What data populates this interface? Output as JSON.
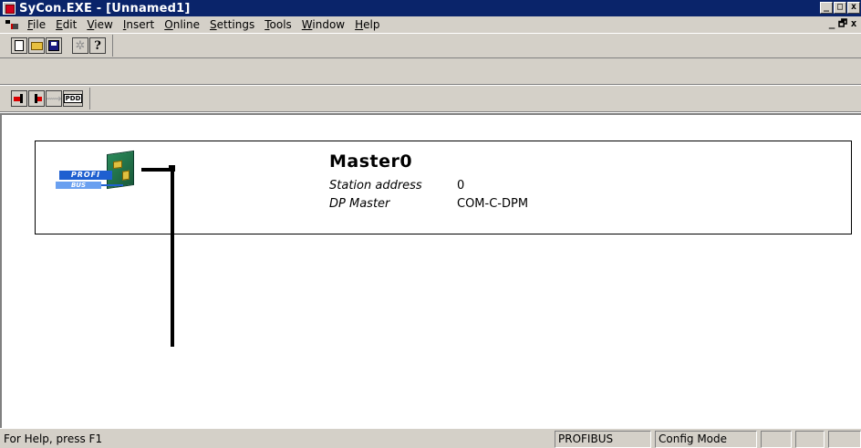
{
  "window": {
    "title": "SyCon.EXE - [Unnamed1]",
    "controls": [
      "_",
      "□",
      "x"
    ],
    "mdi_controls": [
      "_",
      "🗗",
      "x"
    ]
  },
  "menu": {
    "items": [
      {
        "label": "File",
        "underline": "F",
        "rest": "ile"
      },
      {
        "label": "Edit",
        "underline": "E",
        "rest": "dit"
      },
      {
        "label": "View",
        "underline": "V",
        "rest": "iew"
      },
      {
        "label": "Insert",
        "underline": "I",
        "rest": "nsert"
      },
      {
        "label": "Online",
        "underline": "O",
        "rest": "nline"
      },
      {
        "label": "Settings",
        "underline": "S",
        "rest": "ettings"
      },
      {
        "label": "Tools",
        "underline": "T",
        "rest": "ools"
      },
      {
        "label": "Window",
        "underline": "W",
        "rest": "indow"
      },
      {
        "label": "Help",
        "underline": "H",
        "rest": "elp"
      }
    ]
  },
  "toolbar1": {
    "buttons": [
      "new-icon",
      "open-icon",
      "save-icon",
      "ding-icon",
      "help-icon"
    ]
  },
  "toolbar2": {
    "buttons": [
      "insert-master-icon",
      "insert-slave-icon",
      "insert-group-icon",
      "pdd-icon"
    ],
    "pdd_label": "PDD"
  },
  "master": {
    "name": "Master0",
    "station_address_label": "Station address",
    "station_address_value": "0",
    "dp_master_label": "DP Master",
    "dp_master_value": "COM-C-DPM",
    "logo_text_1": "PROFI",
    "logo_text_2": "BUS"
  },
  "statusbar": {
    "help_text": "For Help, press F1",
    "protocol": "PROFIBUS",
    "mode": "Config Mode"
  }
}
